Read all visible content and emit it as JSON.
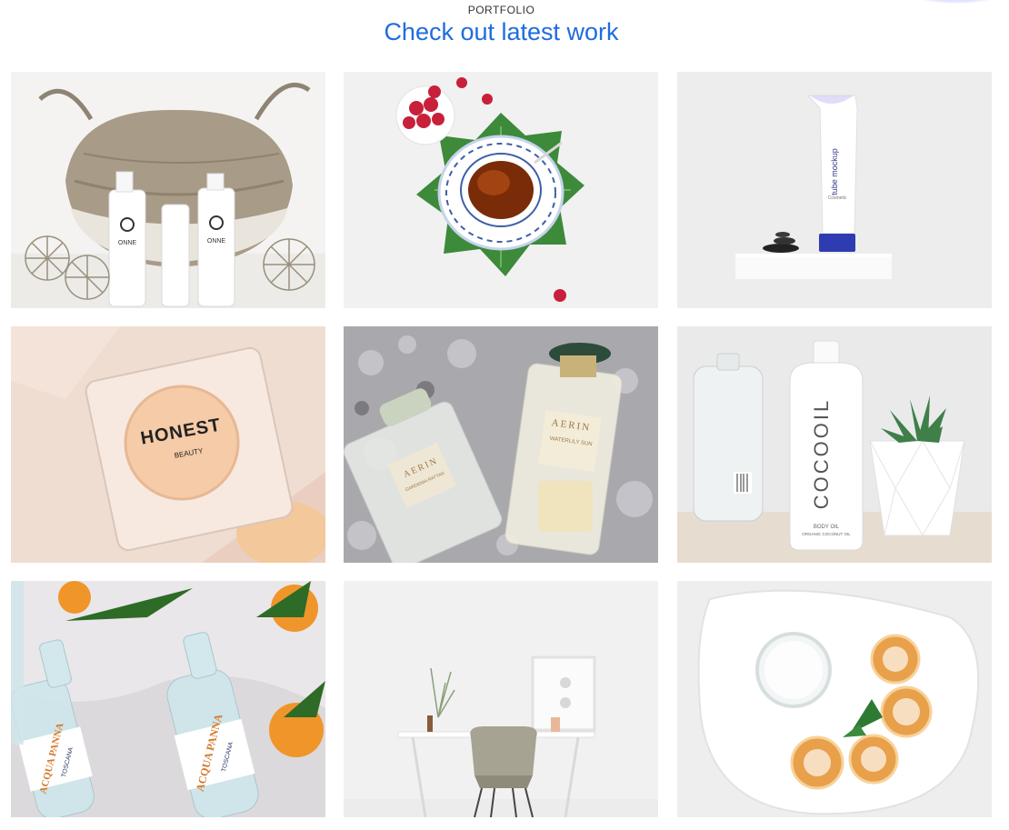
{
  "header": {
    "kicker": "PORTFOLIO",
    "title": "Check out latest work"
  },
  "accent_color": "#1e6ce0",
  "portfolio": {
    "items": [
      {
        "id": "basket-skincare",
        "texts": [
          "ONNE",
          "ONNE"
        ]
      },
      {
        "id": "tea-raspberries",
        "texts": []
      },
      {
        "id": "tube-mockup",
        "texts": [
          "tube mockup",
          "Cosmetic"
        ]
      },
      {
        "id": "honest-beauty",
        "texts": [
          "HONEST",
          "BEAUTY"
        ]
      },
      {
        "id": "aerin-perfume",
        "texts": [
          "AERIN",
          "GARDENIA RATTAN",
          "AERIN",
          "WATERLILY SUN"
        ]
      },
      {
        "id": "cocooil-bottle",
        "texts": [
          "COCOOIL",
          "BODY OIL",
          "ORGANIC COCONUT OIL"
        ]
      },
      {
        "id": "acqua-panna",
        "texts": [
          "ACQUA PANNA",
          "TOSCANA",
          "ACQUA PANNA",
          "TOSCANA"
        ]
      },
      {
        "id": "desk-chair",
        "texts": []
      },
      {
        "id": "plate-pancakes",
        "texts": []
      }
    ]
  }
}
